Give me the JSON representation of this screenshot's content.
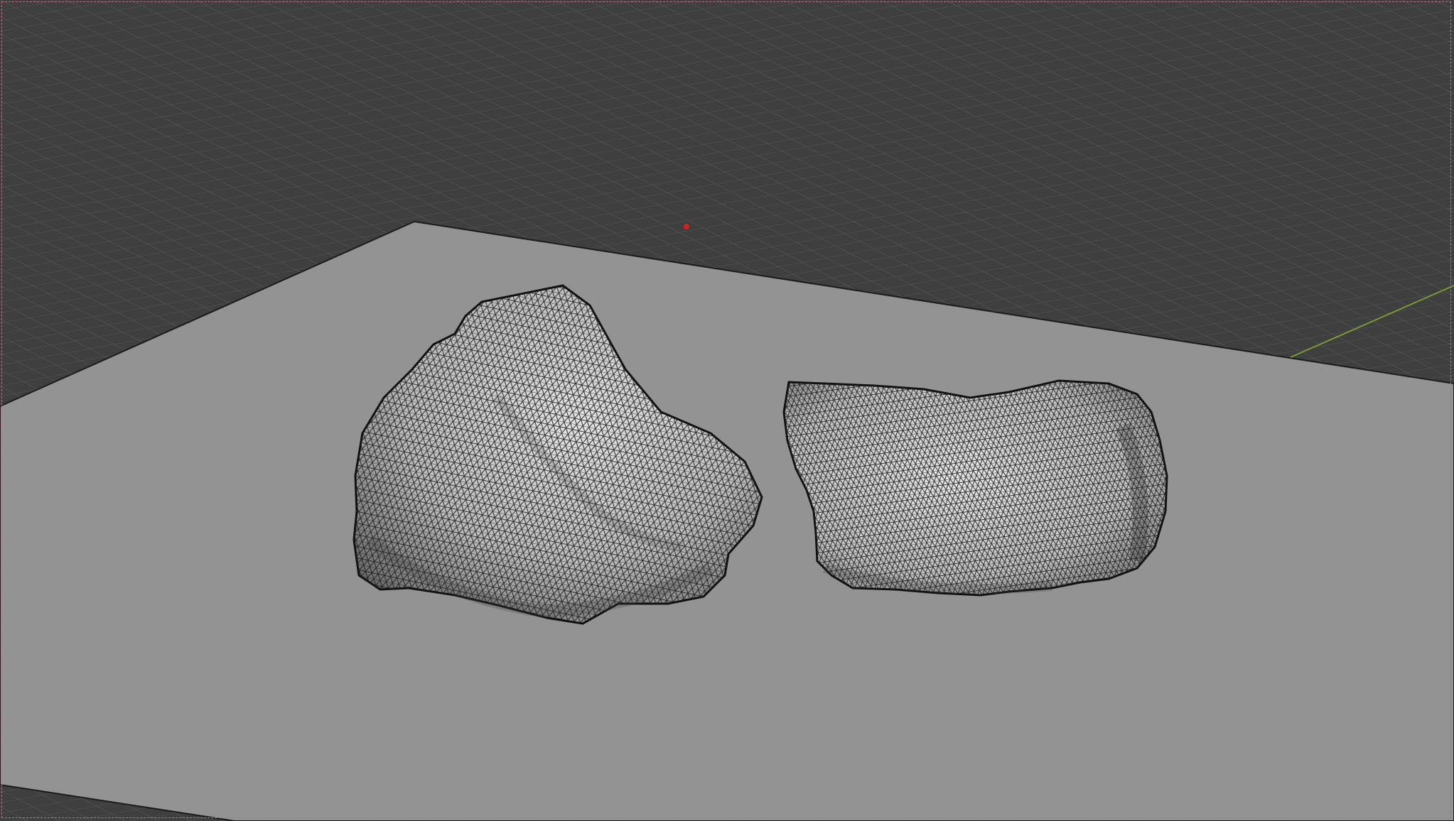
{
  "viewport": {
    "background_color": "#3d3d3d",
    "grid_color": "#555555",
    "plane_color": "#929392",
    "rock_color": "#c9c9c9",
    "wire_color": "#111111",
    "axis_y_color": "#7a9a3a",
    "origin_marker_color": "#d42020",
    "frame_color": "#c07080"
  },
  "scene": {
    "objects": [
      {
        "name": "ground-plane",
        "selected": false
      },
      {
        "name": "rock-left",
        "selected": false
      },
      {
        "name": "rock-right",
        "selected": false
      }
    ]
  }
}
